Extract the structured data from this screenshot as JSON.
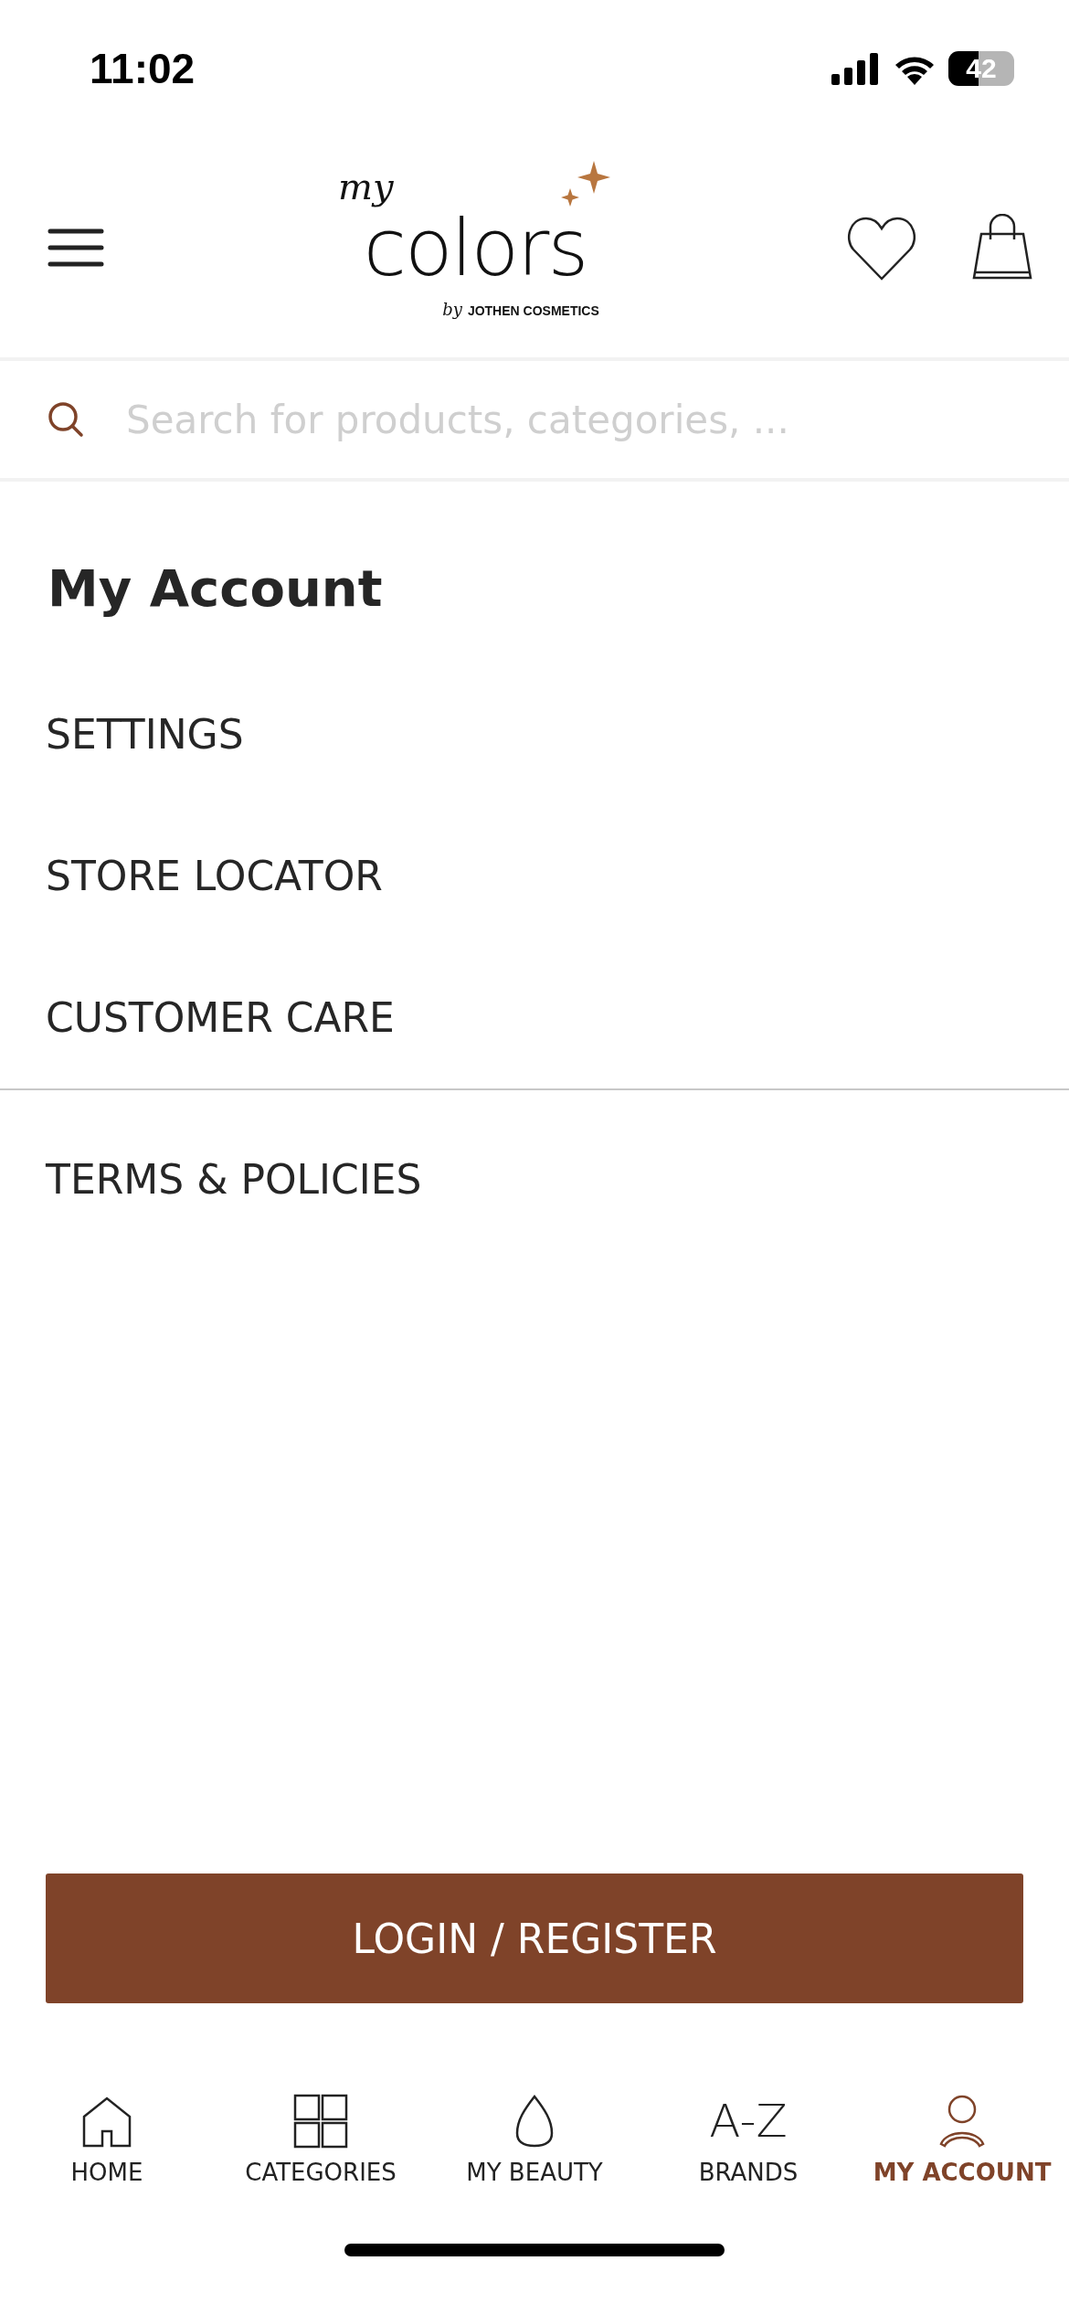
{
  "status_bar": {
    "time": "11:02",
    "battery": "42"
  },
  "header": {
    "logo": {
      "script": "my",
      "word": "colors",
      "by": "by",
      "tagline": "JOTHEN COSMETICS"
    }
  },
  "search": {
    "placeholder": "Search for products, categories, ..."
  },
  "title": "My Account",
  "menu": [
    {
      "label": "SETTINGS",
      "divider_after": false
    },
    {
      "label": "STORE LOCATOR",
      "divider_after": false
    },
    {
      "label": "CUSTOMER CARE",
      "divider_after": true
    },
    {
      "label": "TERMS & POLICIES",
      "divider_after": false
    }
  ],
  "login_button": "LOGIN / REGISTER",
  "tab_bar": [
    {
      "kind": "home",
      "label": "HOME",
      "selected": false
    },
    {
      "kind": "categories",
      "label": "CATEGORIES",
      "selected": false
    },
    {
      "kind": "beauty",
      "label": "MY BEAUTY",
      "selected": false
    },
    {
      "kind": "brands",
      "glyph": "A-Z",
      "label": "BRANDS",
      "selected": false
    },
    {
      "kind": "account",
      "label": "MY ACCOUNT",
      "selected": true
    }
  ]
}
